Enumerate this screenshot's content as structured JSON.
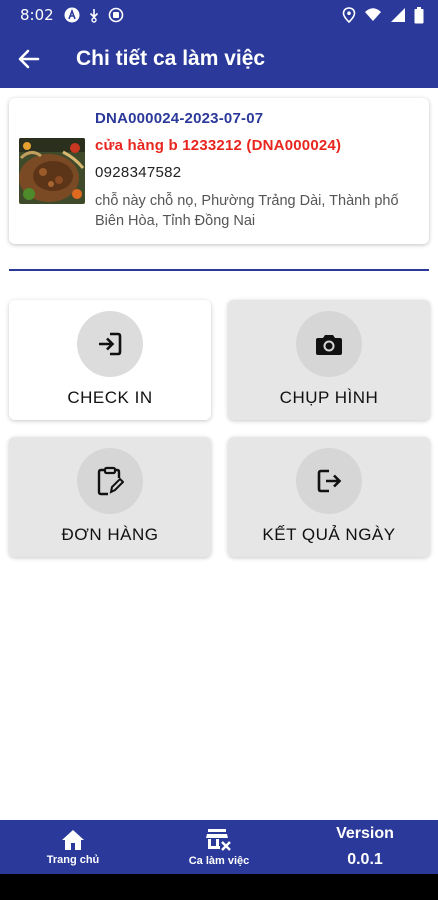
{
  "status_bar": {
    "time": "8:02",
    "left_icons": [
      "a-badge-icon",
      "download-icon",
      "sync-icon"
    ],
    "right_icons": [
      "location-icon",
      "wifi-icon",
      "signal-icon",
      "battery-icon"
    ]
  },
  "app_bar": {
    "back_icon": "arrow-left-icon",
    "title": "Chi tiết ca làm việc"
  },
  "store": {
    "code": "DNA000024-2023-07-07",
    "name": "cửa hàng b 1233212 (DNA000024)",
    "phone": "0928347582",
    "address": "chỗ này chỗ nọ, Phường Trảng Dài, Thành phố Biên Hòa, Tỉnh Đồng Nai"
  },
  "actions": [
    {
      "label": "CHECK IN",
      "icon": "login-icon"
    },
    {
      "label": "CHỤP HÌNH",
      "icon": "camera-icon"
    },
    {
      "label": "ĐƠN HÀNG",
      "icon": "clipboard-edit-icon"
    },
    {
      "label": "KẾT QUẢ NGÀY",
      "icon": "logout-icon"
    }
  ],
  "bottom_nav": {
    "items": [
      {
        "label": "Trang chủ",
        "icon": "home-icon"
      },
      {
        "label": "Ca làm việc",
        "icon": "shop-close-icon"
      }
    ],
    "version_title": "Version",
    "version_number": "0.0.1"
  },
  "colors": {
    "primary": "#2b3a9a",
    "store_name": "#e8261f",
    "tile_grey": "#e6e6e6"
  }
}
